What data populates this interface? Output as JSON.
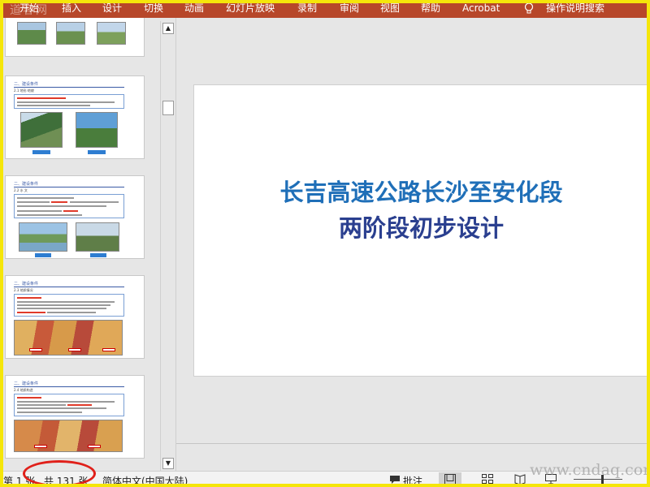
{
  "ribbon": {
    "watermark": "道客网",
    "tabs": [
      "开始",
      "插入",
      "设计",
      "切换",
      "动画",
      "幻灯片放映",
      "录制",
      "审阅",
      "视图",
      "帮助",
      "Acrobat"
    ],
    "tell_me": "操作说明搜索",
    "color": "#b7472a"
  },
  "thumbnails": [
    {
      "heading": "二、建设条件",
      "sub": "2.1 地形·地貌",
      "captions": []
    },
    {
      "heading": "二、建设条件",
      "sub": "2.2 水 文",
      "captions": []
    },
    {
      "heading": "二、建设条件",
      "sub": "2.3 地质情况",
      "captions": []
    },
    {
      "heading": "二、建设条件",
      "sub": "2.4 地质构造",
      "captions": []
    }
  ],
  "scrollbar": {
    "up_icon": "▲",
    "down_icon": "▼"
  },
  "slide": {
    "title_line1": "长吉高速公路长沙至安化段",
    "title_line2": "两阶段初步设计",
    "title_color": "#1f6fb8"
  },
  "status": {
    "slide_counter_left": "第 1 张",
    "slide_counter_right": "共 131 张",
    "language": "简体中文(中国大陆)",
    "comments_label": "批注",
    "watermark": "www.cndaq.com"
  }
}
